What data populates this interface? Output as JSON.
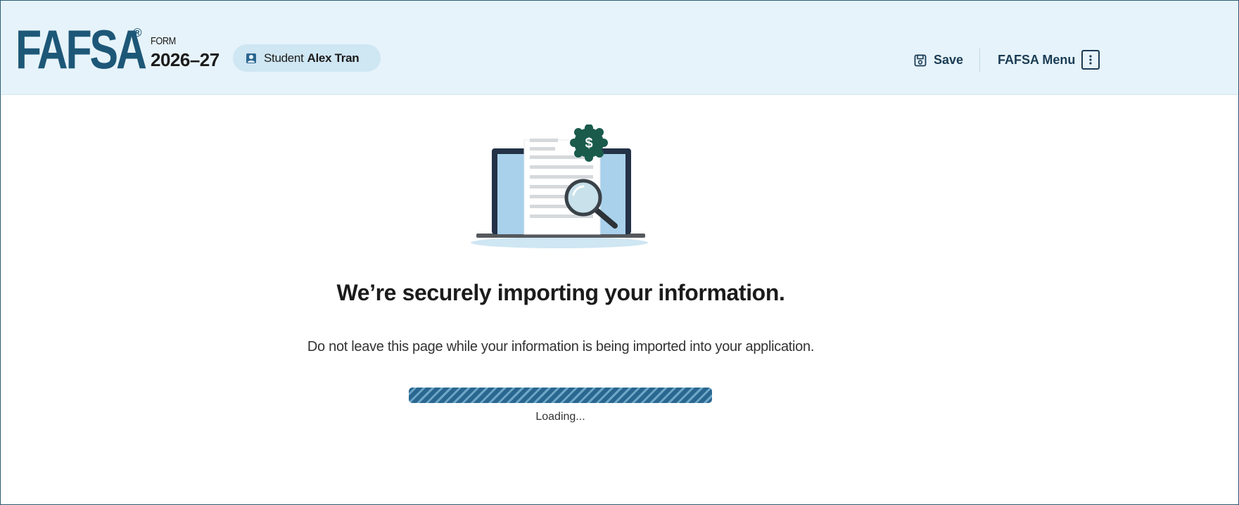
{
  "header": {
    "logo_text": "FAFSA",
    "registered_mark": "®",
    "form_label": "FORM",
    "form_year": "2026–27",
    "user_role": "Student",
    "user_name": "Alex Tran",
    "save_label": "Save",
    "menu_label": "FAFSA Menu",
    "icons": {
      "student": "student-icon",
      "save": "save-disk-icon",
      "menu": "vertical-dots-icon"
    }
  },
  "main": {
    "illustration": "laptop-document-magnifier-illustration",
    "dollar_badge": "$",
    "heading": "We’re securely importing your information.",
    "message": "Do not leave this page while your information is being imported into your application.",
    "progress_percent": 100,
    "loading_label": "Loading..."
  },
  "colors": {
    "header_bg": "#e6f3fa",
    "brand_blue": "#1d5777",
    "progress_dark": "#2a6790",
    "progress_light": "#6ea6c8",
    "badge_green": "#1a5b4c"
  }
}
